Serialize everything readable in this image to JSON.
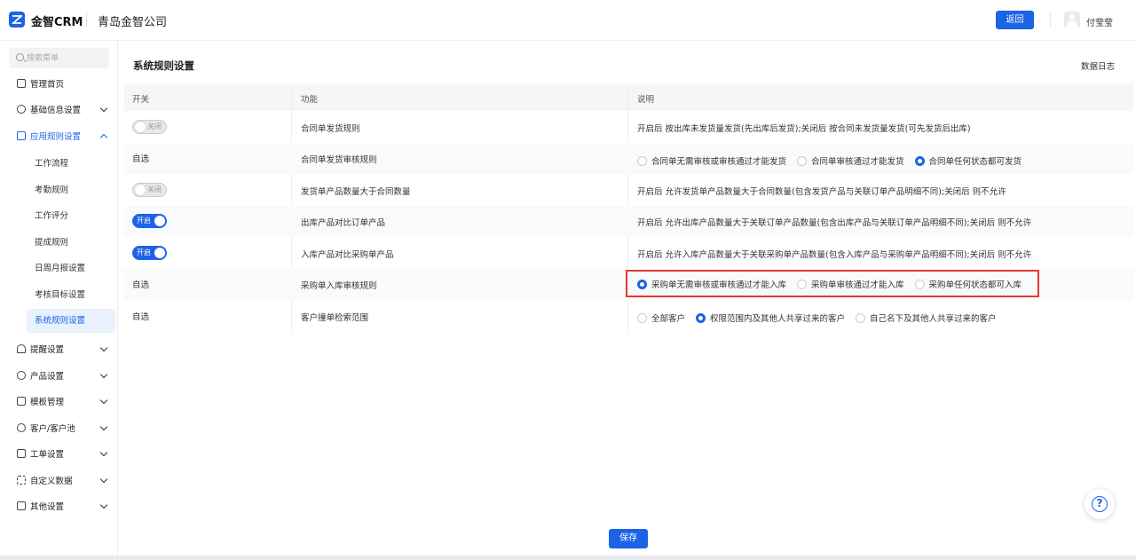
{
  "header": {
    "brand": "金智CRM",
    "company": "青岛金智公司",
    "back_label": "返回",
    "user_name": "付莹莹"
  },
  "sidebar": {
    "search_placeholder": "搜索菜单",
    "items": [
      {
        "label": "管理首页",
        "icon": "home-icon"
      },
      {
        "label": "基础信息设置",
        "icon": "cube-icon"
      },
      {
        "label": "应用规则设置",
        "icon": "document-icon"
      },
      {
        "label": "提醒设置",
        "icon": "bell-icon"
      },
      {
        "label": "产品设置",
        "icon": "box-icon"
      },
      {
        "label": "模板管理",
        "icon": "template-icon"
      },
      {
        "label": "客户/客户池",
        "icon": "customer-icon"
      },
      {
        "label": "工单设置",
        "icon": "ticket-icon"
      },
      {
        "label": "自定义数据",
        "icon": "custom-data-icon"
      },
      {
        "label": "其他设置",
        "icon": "grid-icon"
      }
    ],
    "subitems": [
      "工作流程",
      "考勤规则",
      "工作评分",
      "提成规则",
      "日周月报设置",
      "考核目标设置",
      "系统规则设置"
    ],
    "selected_subitem": "系统规则设置"
  },
  "main": {
    "title": "系统规则设置",
    "log_link": "数据日志",
    "columns": [
      "开关",
      "功能",
      "说明"
    ],
    "rows": [
      {
        "switch": "关闭",
        "function": "合同单发货规则",
        "desc": "开启后 按出库未发货量发货(先出库后发货);关闭后 按合同未发货量发货(可先发货后出库)"
      },
      {
        "switch": "自选",
        "function": "合同单发货审核规则",
        "options": [
          "合同单无需审核或审核通过才能发货",
          "合同单审核通过才能发货",
          "合同单任何状态都可发货"
        ],
        "selected": 2
      },
      {
        "switch": "关闭",
        "function": "发货单产品数量大于合同数量",
        "desc": "开启后 允许发货单产品数量大于合同数量(包含发货产品与关联订单产品明细不同);关闭后 则不允许"
      },
      {
        "switch": "开启",
        "function": "出库产品对比订单产品",
        "desc": "开启后 允许出库产品数量大于关联订单产品数量(包含出库产品与关联订单产品明细不同);关闭后 则不允许"
      },
      {
        "switch": "开启",
        "function": "入库产品对比采购单产品",
        "desc": "开启后 允许入库产品数量大于关联采购单产品数量(包含入库产品与采购单产品明细不同);关闭后 则不允许"
      },
      {
        "switch": "自选",
        "function": "采购单入库审核规则",
        "options": [
          "采购单无需审核或审核通过才能入库",
          "采购单审核通过才能入库",
          "采购单任何状态都可入库"
        ],
        "selected": 0
      },
      {
        "switch": "自选",
        "function": "客户撞单检索范围",
        "options": [
          "全部客户",
          "权限范围内及其他人共享过来的客户",
          "自己名下及其他人共享过来的客户"
        ],
        "selected": 1
      }
    ],
    "save_label": "保存",
    "help_glyph": "?"
  },
  "colors": {
    "accent": "#1c63e8",
    "highlight": "#e53935"
  }
}
